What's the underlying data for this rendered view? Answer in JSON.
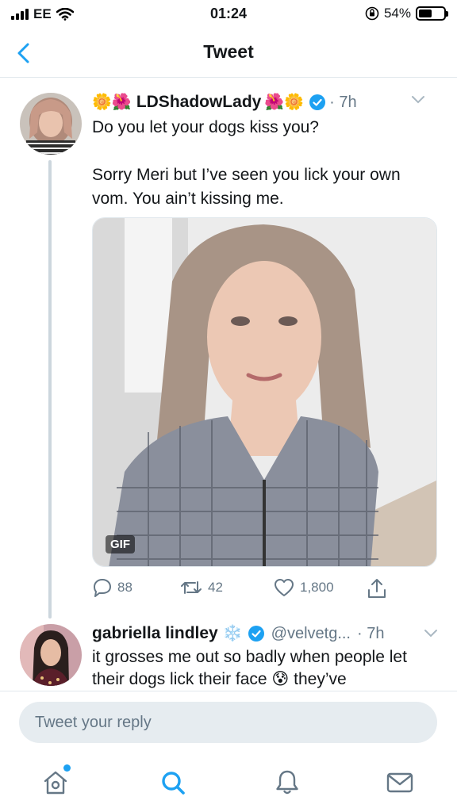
{
  "status_bar": {
    "carrier": "EE",
    "time": "01:24",
    "battery": "54%",
    "battery_level": 0.54
  },
  "nav": {
    "title": "Tweet"
  },
  "tweet": {
    "display_name": "LDShadowLady",
    "name_emoji_left": "🌼🌺",
    "name_emoji_right": "🌺🌼",
    "time": "· 7h",
    "text_line1": "Do you let your dogs kiss you?",
    "text_line2": "Sorry Meri but I’ve seen you lick your own vom. You ain’t kissing me.",
    "media_badge": "GIF",
    "replies": "88",
    "retweets": "42",
    "likes": "1,800"
  },
  "reply": {
    "display_name": "gabriella lindley",
    "name_emoji": "❄️",
    "handle": "@velvetg...",
    "time": "· 7h",
    "text": "it grosses me out so badly when people let their dogs lick their face 😰 they’ve"
  },
  "composer": {
    "placeholder": "Tweet your reply"
  },
  "colors": {
    "accent": "#1da1f2",
    "muted": "#657786",
    "divider": "#e1e8ed",
    "input_bg": "#e6ecf0"
  },
  "icons": {
    "back": "chevron-left-icon",
    "verified": "verified-badge-icon",
    "reply": "comment-icon",
    "retweet": "retweet-icon",
    "like": "heart-icon",
    "share": "share-icon",
    "home": "home-icon",
    "search": "search-icon",
    "notifications": "bell-icon",
    "messages": "envelope-icon"
  }
}
